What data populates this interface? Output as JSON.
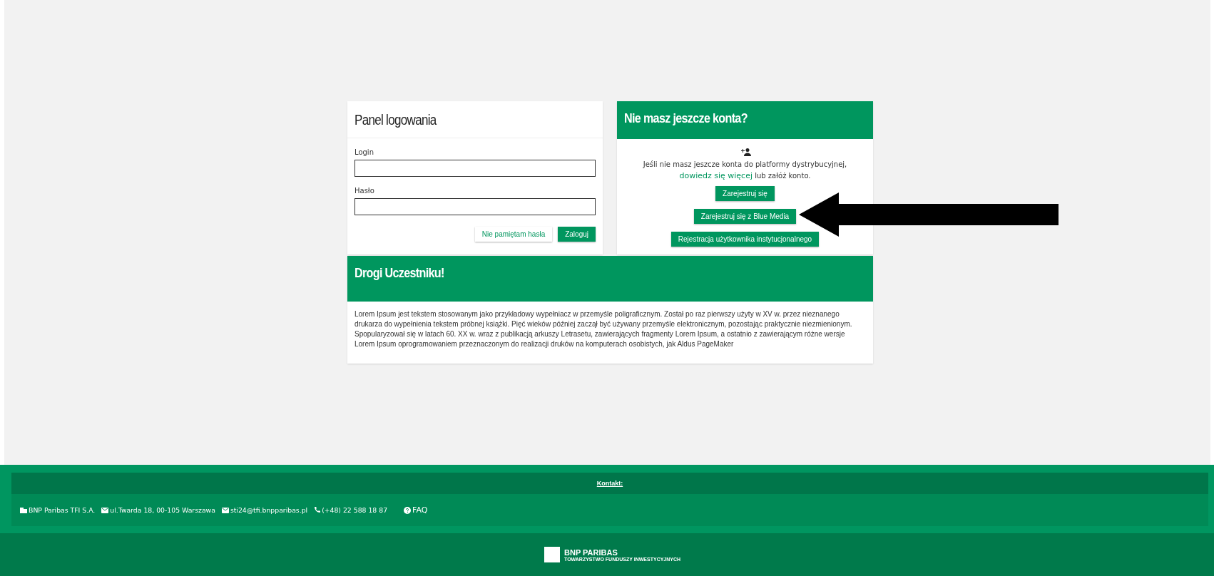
{
  "login_panel": {
    "title": "Panel logowania",
    "fields": [
      {
        "label": "Login"
      },
      {
        "label": "Hasło"
      }
    ],
    "buttons": [
      {
        "label": "Nie pamiętam hasła",
        "kind": "outline"
      },
      {
        "label": "Zaloguj",
        "kind": "primary"
      }
    ]
  },
  "register_panel": {
    "title": "Nie masz jeszcze konta?",
    "text_before": "Jeśli nie masz jeszcze konta do platformy dystrybucyjnej,",
    "link": "dowiedz się więcej",
    "text_after": "lub załóż konto.",
    "buttons": [
      "Zarejestruj się",
      "Zarejestruj się z Blue Media",
      "Rejestracja użytkownika instytucjonalnego"
    ]
  },
  "notice_panel": {
    "title": "Drogi Uczestniku!",
    "body": "Lorem Ipsum jest tekstem stosowanym jako przykładowy wypełniacz w przemyśle poligraficznym. Został po raz pierwszy użyty w XV w. przez nieznanego drukarza do wypełnienia tekstem próbnej książki. Pięć wieków później zaczął być używany przemyśle elektronicznym, pozostając praktycznie niezmienionym. Spopularyzował się w latach 60. XX w. wraz z publikacją arkuszy Letrasetu, zawierających fragmenty Lorem Ipsum, a ostatnio z zawierającym różne wersje Lorem Ipsum oprogramowaniem przeznaczonym do realizacji druków na komputerach osobistych, jak Aldus PageMaker"
  },
  "footer": {
    "heading": "Kontakt:",
    "items": [
      {
        "kind": "company",
        "text": "BNP Paribas TFI S.A."
      },
      {
        "kind": "address",
        "text": "ul.Twarda 18, 00-105 Warszawa"
      },
      {
        "kind": "email",
        "text": "sti24@tfi.bnpparibas.pl"
      },
      {
        "kind": "phone",
        "text": "(+48) 22 588 18 87"
      },
      {
        "kind": "faq",
        "text": "FAQ"
      }
    ],
    "logo": {
      "name": "BNP PARIBAS",
      "subtitle": "TOWARZYSTWO FUNDUSZY INWESTYCYJNYCH"
    }
  }
}
